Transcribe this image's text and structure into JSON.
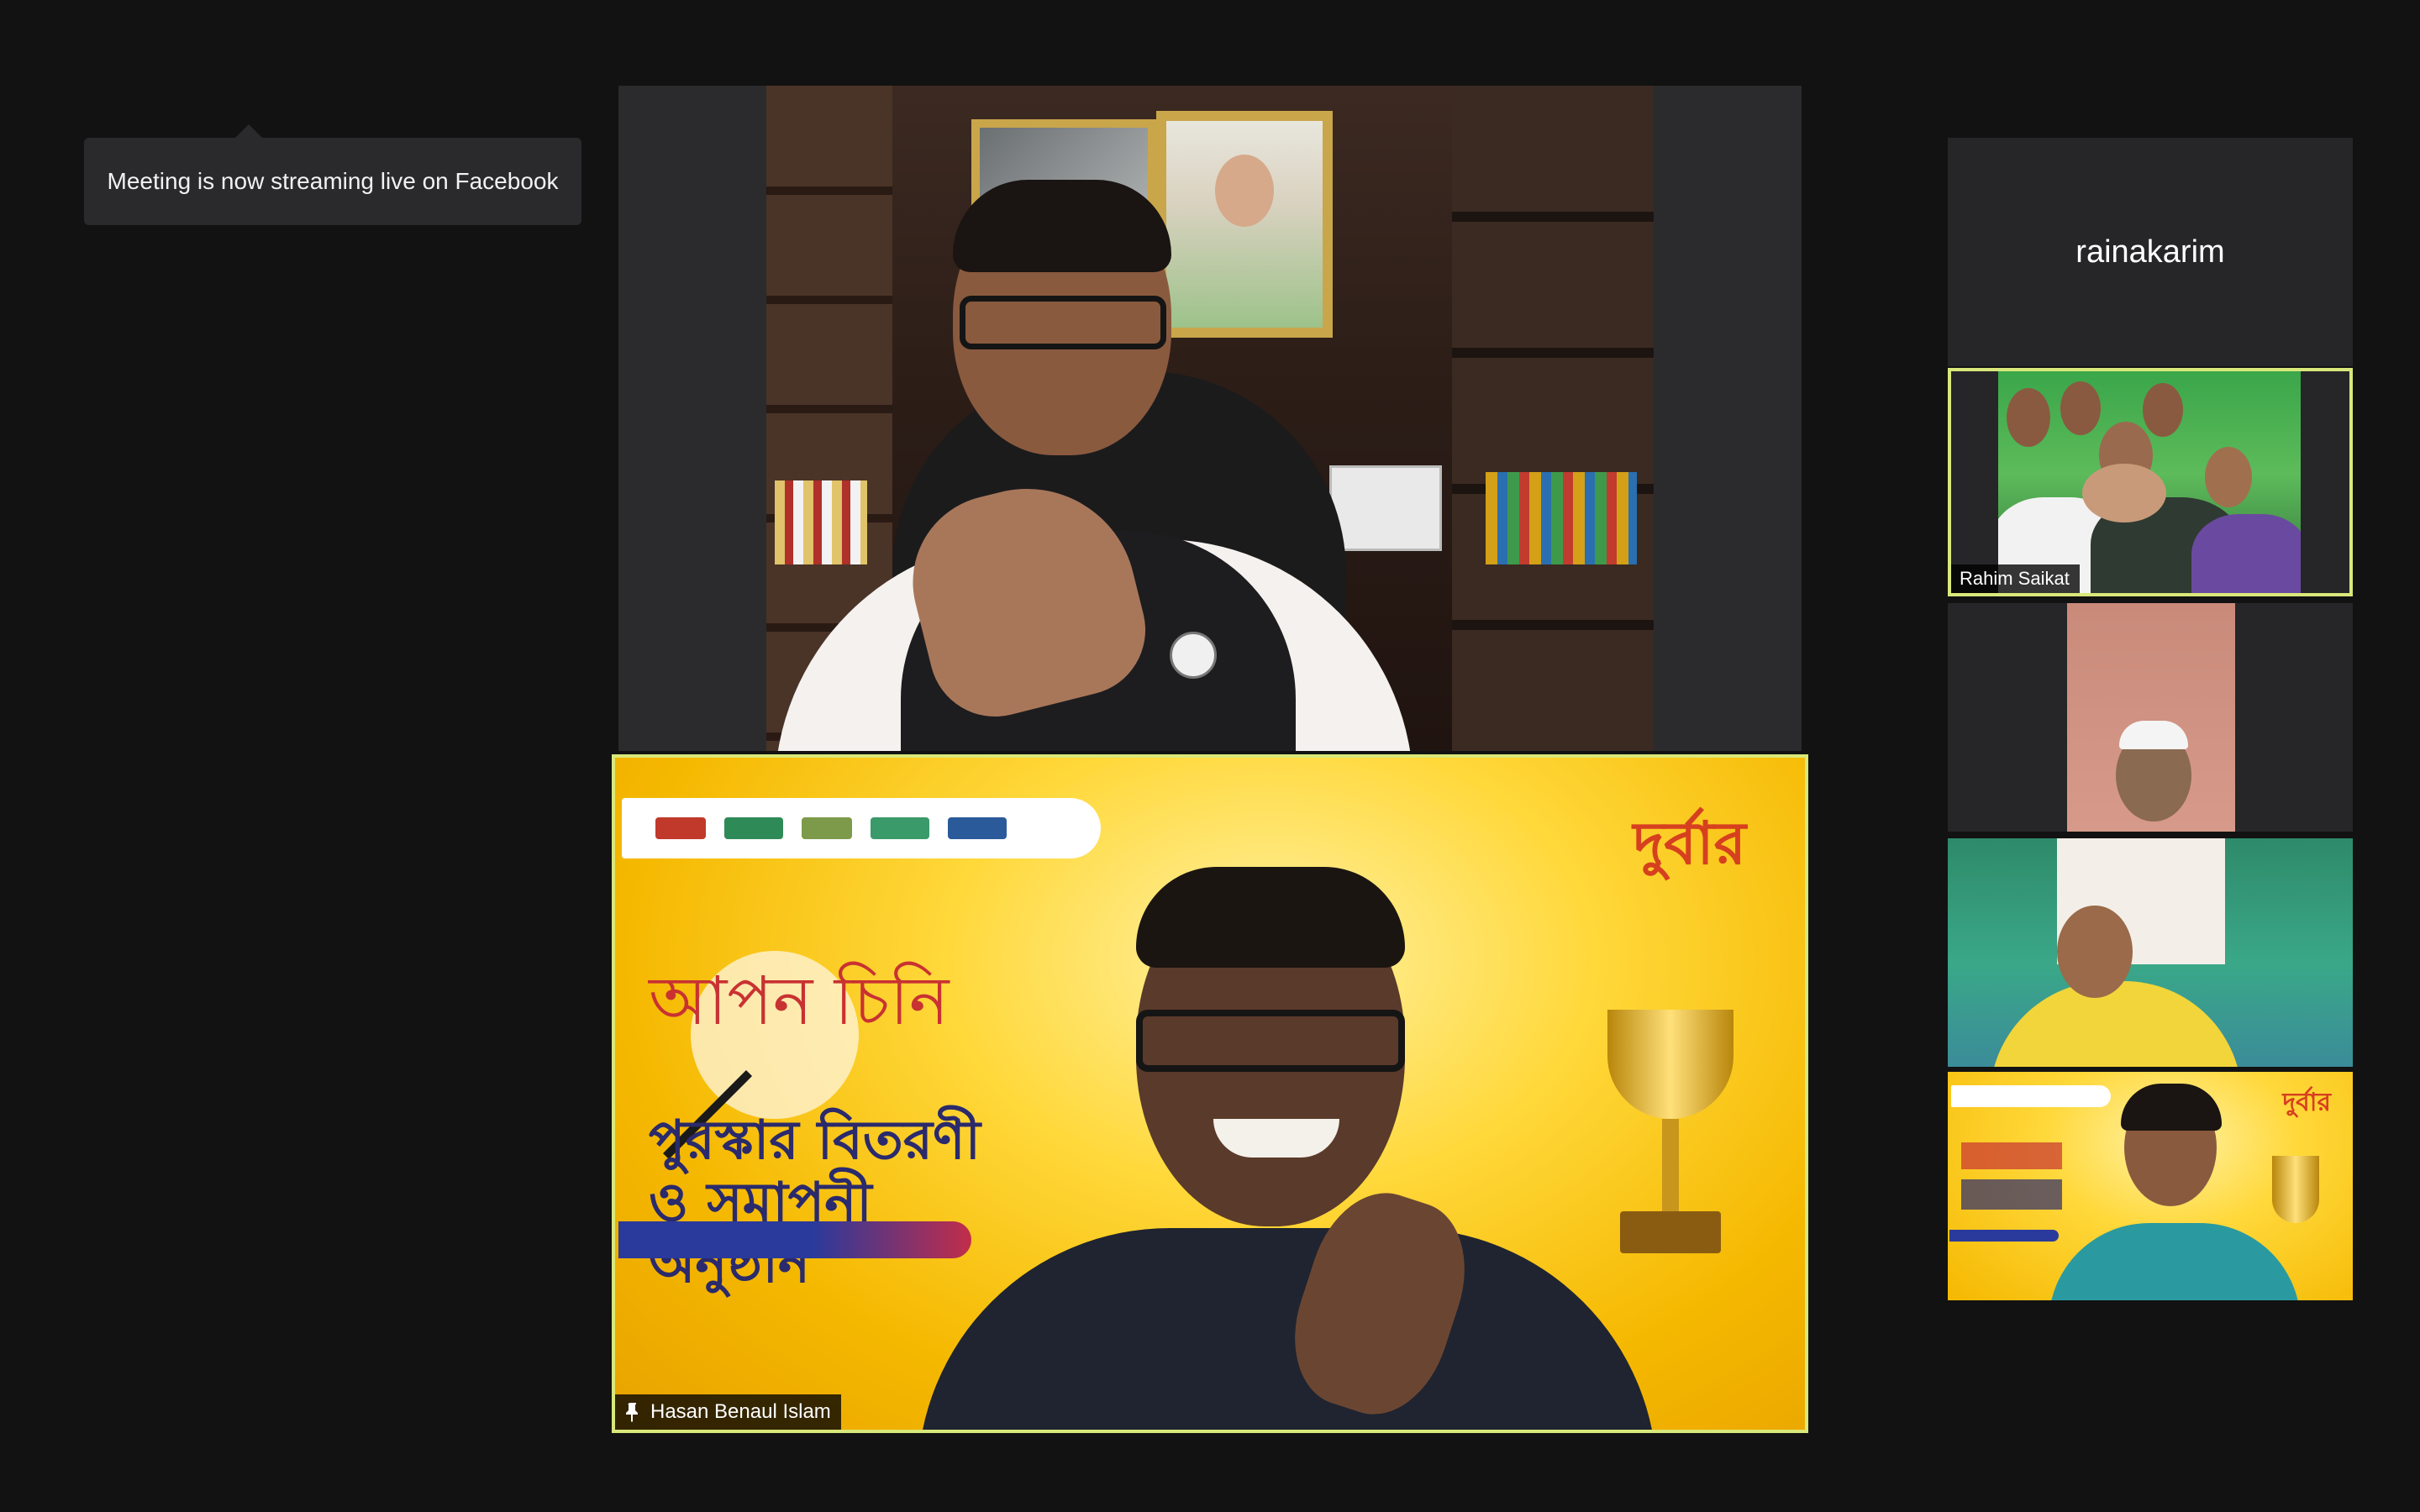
{
  "notification": {
    "message": "Meeting is now streaming live on Facebook"
  },
  "main_video": {
    "participant": ""
  },
  "speaker_video": {
    "participant_name": "Hasan Benaul Islam",
    "pinned": true,
    "icon": "pin-icon"
  },
  "gallery": {
    "tiles": [
      {
        "name": "rainakarim",
        "video": false
      },
      {
        "name": "Rahim Saikat",
        "video": true,
        "active": true
      },
      {
        "name": "",
        "video": true
      },
      {
        "name": "",
        "video": true
      },
      {
        "name": "",
        "video": true
      }
    ]
  },
  "colors": {
    "background": "#121212",
    "tile_background": "#262628",
    "active_speaker_border": "#d9e87a",
    "toast_background": "#2a2a2c"
  }
}
